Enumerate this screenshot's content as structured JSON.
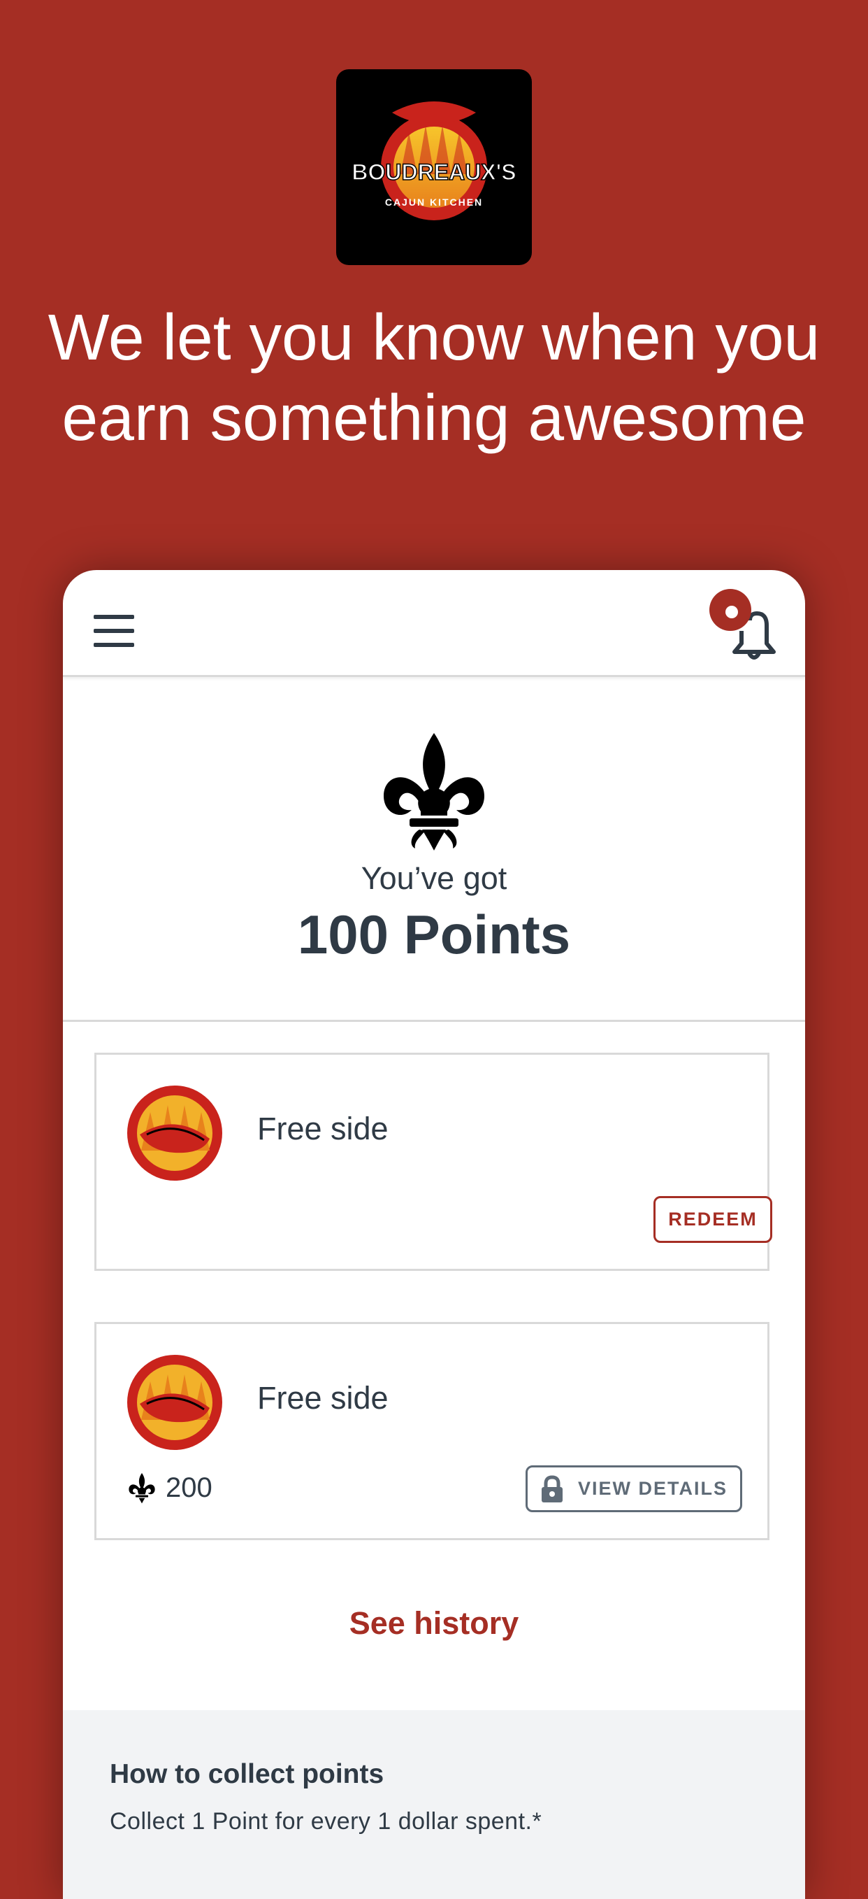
{
  "brand": {
    "logo_name": "BOUDREAUX'S",
    "logo_tagline": "CAJUN KITCHEN",
    "accent": "#a52e24"
  },
  "headline": "We let you know when you earn something awesome",
  "app": {
    "menu_icon": "hamburger-menu-icon",
    "notifications_icon": "bell-icon",
    "points_label": "You’ve got",
    "points_value": "100 Points",
    "rewards": [
      {
        "title": "Free side",
        "action_label": "REDEEM",
        "locked": false
      },
      {
        "title": "Free side",
        "cost": "200",
        "action_label": "VIEW DETAILS",
        "locked": true
      }
    ],
    "history_link": "See history",
    "collect": {
      "heading": "How to collect points",
      "text": "Collect 1 Point for every 1 dollar spent.*"
    }
  }
}
